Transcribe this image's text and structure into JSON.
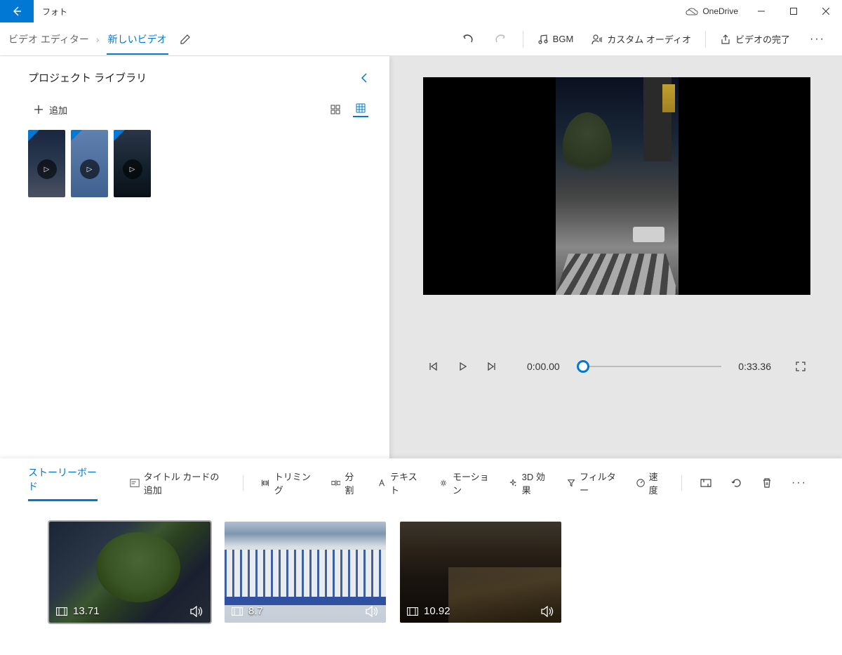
{
  "titlebar": {
    "app_title": "フォト",
    "onedrive": "OneDrive"
  },
  "breadcrumbs": {
    "parent": "ビデオ エディター",
    "current": "新しいビデオ"
  },
  "toolbar": {
    "undo": "元に戻す",
    "redo": "やり直し",
    "bgm": "BGM",
    "custom_audio": "カスタム オーディオ",
    "finish": "ビデオの完了"
  },
  "library": {
    "title": "プロジェクト ライブラリ",
    "add": "追加"
  },
  "player": {
    "current_time": "0:00.00",
    "total_time": "0:33.36"
  },
  "storyboard": {
    "title": "ストーリーボード",
    "add_title_card": "タイトル カードの追加",
    "trim": "トリミング",
    "split": "分割",
    "text": "テキスト",
    "motion": "モーション",
    "effects_3d": "3D 効果",
    "filters": "フィルター",
    "speed": "速度",
    "clips": [
      {
        "duration": "13.71",
        "selected": true
      },
      {
        "duration": "8.7",
        "selected": false
      },
      {
        "duration": "10.92",
        "selected": false
      }
    ]
  }
}
